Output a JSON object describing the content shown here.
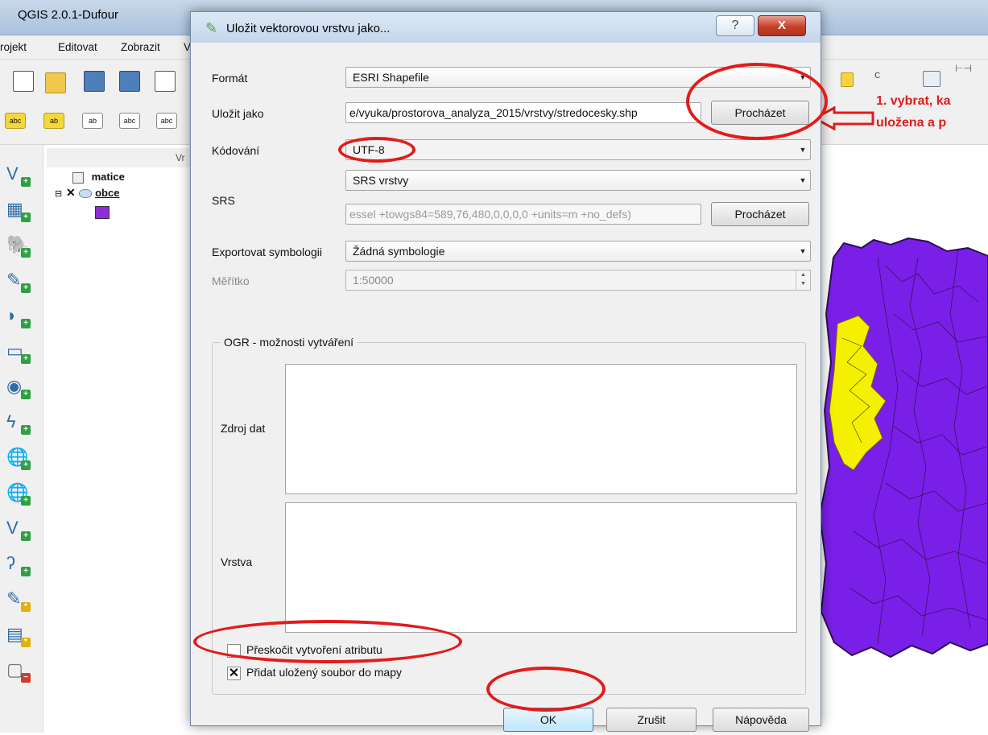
{
  "qgis": {
    "title": "QGIS 2.0.1-Dufour",
    "menu": [
      "rojekt",
      "Editovat",
      "Zobrazit",
      "V"
    ],
    "layers_panel_title": "Vr",
    "layers": [
      {
        "name": "matice"
      },
      {
        "name": "obce"
      }
    ],
    "colors": {
      "map_fill": "#7a1fe8",
      "map_highlight": "#f4f000"
    }
  },
  "annotation": {
    "line1": "1. vybrat, ka",
    "line2": "uložena a p"
  },
  "dialog": {
    "title": "Uložit vektorovou vrstvu jako...",
    "help_glyph": "?",
    "close_glyph": "X",
    "format": {
      "label": "Formát",
      "value": "ESRI Shapefile"
    },
    "save_as": {
      "label": "Uložit jako",
      "value": "e/vyuka/prostorova_analyza_2015/vrstvy/stredocesky.shp",
      "browse": "Procházet"
    },
    "encoding": {
      "label": "Kódování",
      "value": "UTF-8"
    },
    "srs": {
      "label": "SRS",
      "combo": "SRS vrstvy",
      "proj": "essel +towgs84=589,76,480,0,0,0,0 +units=m +no_defs)",
      "browse": "Procházet"
    },
    "symbology": {
      "label": "Exportovat symbologii",
      "value": "Žádná symbologie"
    },
    "scale": {
      "label": "Měřítko",
      "value": "1:50000"
    },
    "ogr": {
      "title": "OGR - možnosti vytváření",
      "datasource_label": "Zdroj dat",
      "layer_label": "Vrstva"
    },
    "skip_attr": {
      "label": "Přeskočit vytvoření atributu",
      "checked": false
    },
    "add_to_map": {
      "label": "Přidat uložený soubor do mapy",
      "checked": true
    },
    "buttons": {
      "ok": "OK",
      "cancel": "Zrušit",
      "help": "Nápověda"
    }
  }
}
